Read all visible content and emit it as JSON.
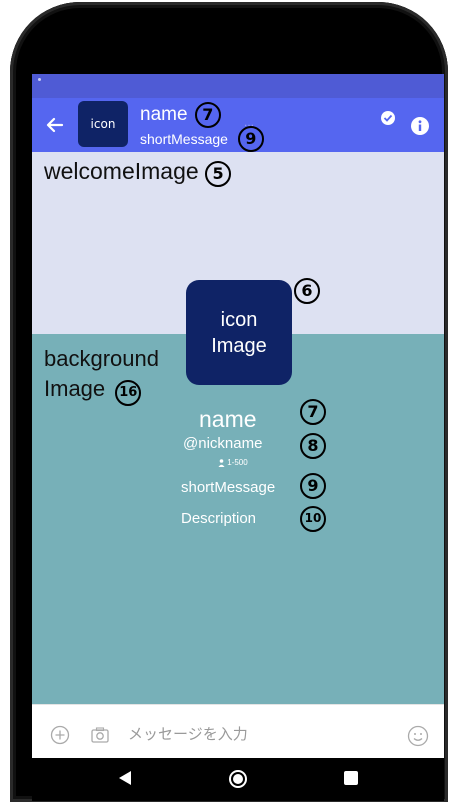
{
  "header": {
    "back_icon": "arrow-left-icon",
    "avatar_label": "icon",
    "name": "name",
    "short_message": "shortMessage",
    "dots": "…",
    "check_icon": "check-circle-icon",
    "info_icon": "info-icon",
    "badge_name": "7",
    "badge_short": "9",
    "color": "#5566f0"
  },
  "welcome": {
    "label": "welcomeImage",
    "badge": "5",
    "color": "#dde1f2"
  },
  "icon_image": {
    "line1": "icon",
    "line2": "Image",
    "badge": "6",
    "color": "#0f2366"
  },
  "background": {
    "line1": "background",
    "line2": "Image",
    "badge": "16",
    "color": "#77b0b8"
  },
  "profile": {
    "name": "name",
    "name_badge": "7",
    "nickname": "@nickname",
    "nickname_badge": "8",
    "member_count": "1-500",
    "short_message": "shortMessage",
    "short_badge": "9",
    "description": "Description",
    "description_badge": "10"
  },
  "input_bar": {
    "plus_icon": "plus-circle-icon",
    "camera_icon": "camera-icon",
    "placeholder": "メッセージを入力",
    "emoji_icon": "smiley-icon"
  },
  "nav": {
    "back_icon": "triangle-back-icon",
    "home_icon": "circle-home-icon",
    "recent_icon": "square-recents-icon"
  }
}
